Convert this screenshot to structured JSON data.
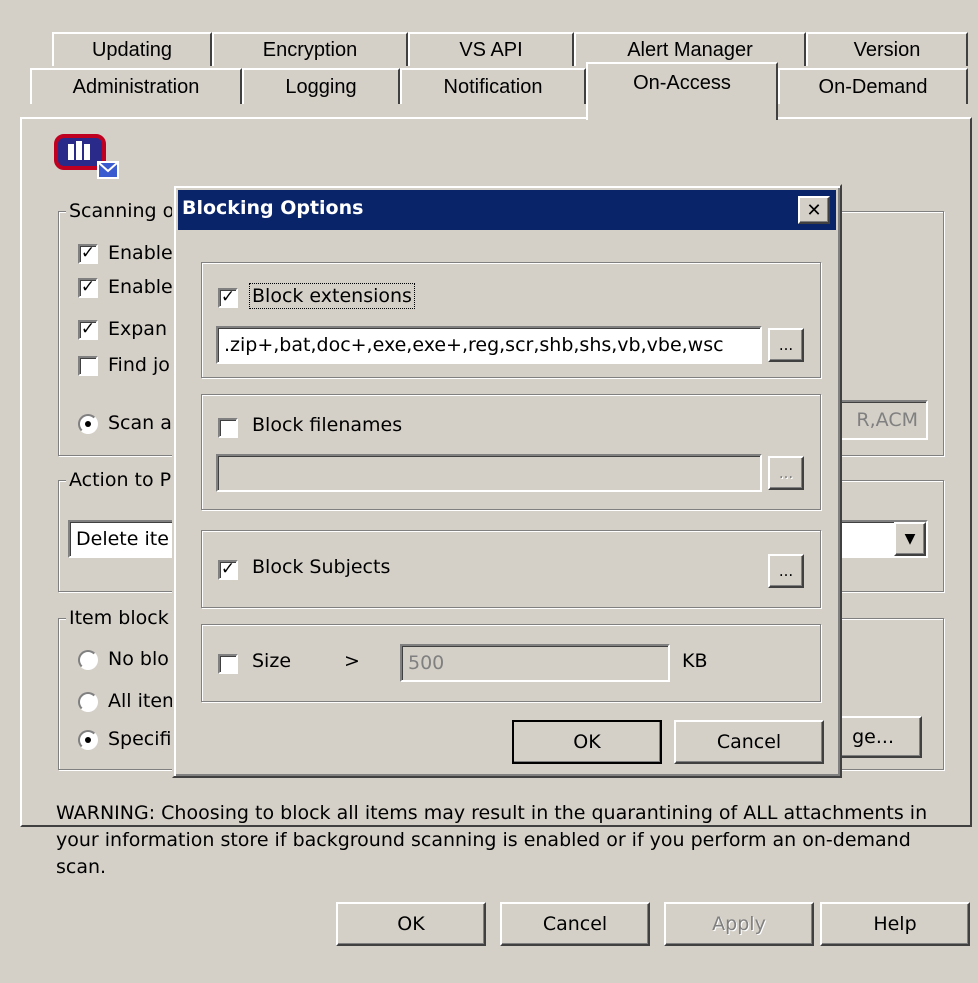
{
  "tabs": {
    "row1": [
      "Updating",
      "Encryption",
      "VS API",
      "Alert Manager",
      "Version"
    ],
    "row2": [
      "Administration",
      "Logging",
      "Notification",
      "On-Access",
      "On-Demand"
    ]
  },
  "background_panel": {
    "scanning_group_label": "Scanning o",
    "checkboxes": [
      {
        "label": "Enable",
        "checked": true
      },
      {
        "label": "Enable",
        "checked": true
      },
      {
        "label": "Expan",
        "checked": true
      },
      {
        "label": "Find jo",
        "checked": false
      }
    ],
    "scan_radio_label": "Scan a",
    "scan_field_tail": "R,ACM",
    "action_group_label": "Action to P",
    "action_select_value": "Delete ite",
    "item_block_group_label": "Item block",
    "item_radios": [
      {
        "label": "No blo",
        "selected": false
      },
      {
        "label": "All item",
        "selected": false
      },
      {
        "label": "Specifi",
        "selected": true
      }
    ],
    "change_button_tail": "ge...",
    "warning": "WARNING: Choosing to block all items may result in the quarantining of ALL attachments in your information store if background scanning is enabled or if you perform an on-demand scan."
  },
  "footer_buttons": {
    "ok": "OK",
    "cancel": "Cancel",
    "apply": "Apply",
    "help": "Help"
  },
  "dialog": {
    "title": "Blocking Options",
    "close_glyph": "✕",
    "block_extensions": {
      "label": "Block extensions",
      "checked": true,
      "value": ".zip+,bat,doc+,exe,exe+,reg,scr,shb,shs,vb,vbe,wsc"
    },
    "block_filenames": {
      "label": "Block filenames",
      "checked": false,
      "value": ""
    },
    "block_subjects": {
      "label": "Block Subjects",
      "checked": true
    },
    "size": {
      "label": "Size",
      "checked": false,
      "operator": ">",
      "value": "500",
      "unit": "KB"
    },
    "browse_label": "...",
    "ok": "OK",
    "cancel": "Cancel"
  },
  "colors": {
    "titlebar": "#0a246a",
    "face": "#d4d0c8"
  }
}
